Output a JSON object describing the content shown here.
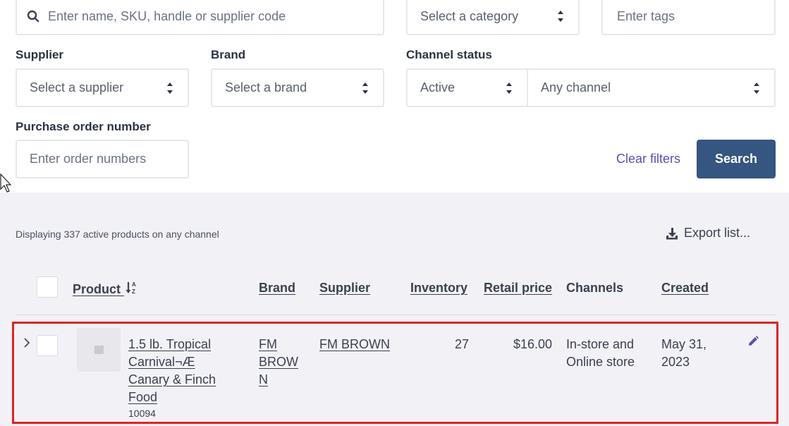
{
  "filters": {
    "search_placeholder": "Enter name, SKU, handle or supplier code",
    "category_value": "Select a category",
    "tags_placeholder": "Enter tags",
    "supplier_label": "Supplier",
    "supplier_value": "Select a supplier",
    "brand_label": "Brand",
    "brand_value": "Select a brand",
    "channel_status_label": "Channel status",
    "status_value": "Active",
    "channel_value": "Any channel",
    "po_label": "Purchase order number",
    "po_placeholder": "Enter order numbers",
    "clear_label": "Clear filters",
    "search_label": "Search"
  },
  "results": {
    "summary": "Displaying 337 active products on any channel",
    "export_label": "Export list..."
  },
  "table": {
    "headers": {
      "product": "Product",
      "brand": "Brand",
      "supplier": "Supplier",
      "inventory": "Inventory",
      "retail_price": "Retail price",
      "channels": "Channels",
      "created": "Created"
    },
    "rows": [
      {
        "product_line1": "1.5 lb. Tropical",
        "product_line2": "Carnival¬Æ",
        "product_line3": "Canary & Finch",
        "product_line4": "Food",
        "sku": "10094",
        "brand_line1": "FM",
        "brand_line2": "BROW",
        "brand_line3": "N",
        "supplier": "FM BROWN",
        "inventory": "27",
        "retail_price": "$16.00",
        "channels_line1": "In-store and",
        "channels_line2": "Online store",
        "created_line1": "May 31,",
        "created_line2": "2023"
      }
    ]
  },
  "colors": {
    "primary_button": "#355680",
    "link": "#5a4fb2",
    "highlight_border": "#e02424",
    "results_background": "#f2f1f6"
  },
  "icons": [
    "search-icon",
    "sort-arrows-icon",
    "download-icon",
    "sort-alpha-icon",
    "chevron-right-icon",
    "pencil-icon",
    "mouse-cursor-icon"
  ]
}
